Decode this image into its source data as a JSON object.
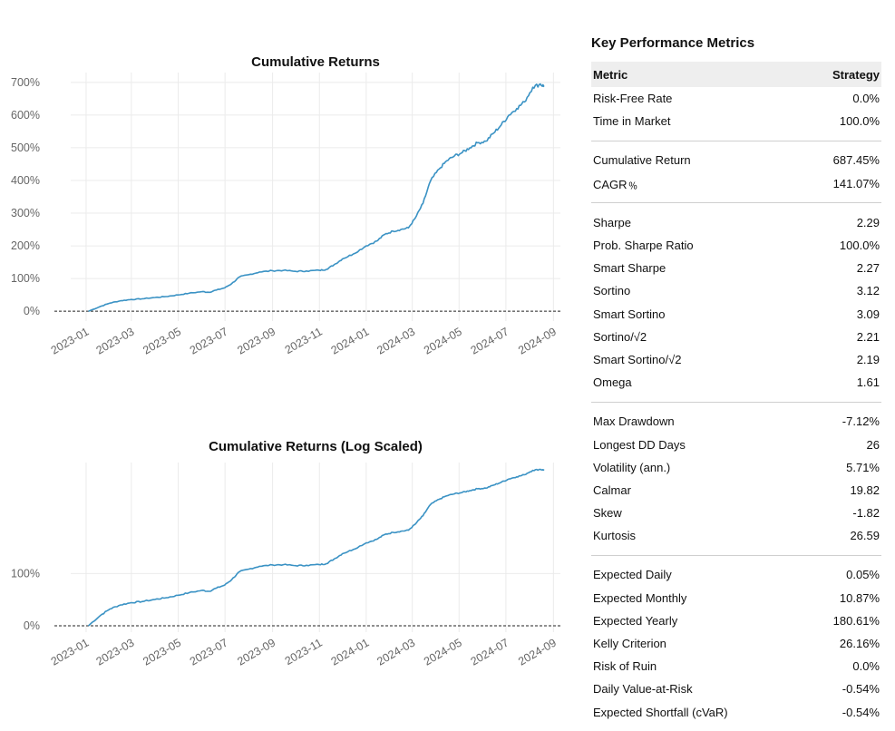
{
  "colors": {
    "series": "#3a92c4",
    "grid": "#ebebeb",
    "zero_line": "#222222",
    "header_bg": "#eeeeee"
  },
  "chart_data": [
    {
      "type": "line",
      "title": "Cumulative Returns",
      "xlabel": "",
      "ylabel": "",
      "y_scale": "linear",
      "ylim": [
        -0.3,
        7.3
      ],
      "y_ticks": [
        0,
        1,
        2,
        3,
        4,
        5,
        6,
        7
      ],
      "y_tick_labels": [
        "0%",
        "100%",
        "200%",
        "300%",
        "400%",
        "500%",
        "600%",
        "700%"
      ],
      "x_ticks": [
        "2023-01",
        "2023-03",
        "2023-05",
        "2023-07",
        "2023-09",
        "2023-11",
        "2024-01",
        "2024-03",
        "2024-05",
        "2024-07",
        "2024-09"
      ],
      "grid": true,
      "series": [
        {
          "x": [
            "2023-01-04",
            "2023-01-20",
            "2023-02-01",
            "2023-02-15",
            "2023-03-01",
            "2023-03-15",
            "2023-04-01",
            "2023-04-15",
            "2023-05-01",
            "2023-05-15",
            "2023-06-01",
            "2023-06-10",
            "2023-06-20",
            "2023-07-01",
            "2023-07-10",
            "2023-07-20",
            "2023-08-01",
            "2023-08-15",
            "2023-09-01",
            "2023-09-15",
            "2023-10-01",
            "2023-10-15",
            "2023-11-01",
            "2023-11-10",
            "2023-11-20",
            "2023-12-01",
            "2023-12-15",
            "2024-01-01",
            "2024-01-15",
            "2024-01-25",
            "2024-02-05",
            "2024-02-15",
            "2024-02-25",
            "2024-03-05",
            "2024-03-15",
            "2024-03-25",
            "2024-04-05",
            "2024-04-15",
            "2024-04-25",
            "2024-05-05",
            "2024-05-15",
            "2024-05-25",
            "2024-06-05",
            "2024-06-15",
            "2024-06-25",
            "2024-07-05",
            "2024-07-15",
            "2024-07-25",
            "2024-08-05",
            "2024-08-15",
            "2024-08-20"
          ],
          "y": [
            0.0,
            0.15,
            0.25,
            0.32,
            0.36,
            0.38,
            0.42,
            0.45,
            0.5,
            0.55,
            0.6,
            0.58,
            0.65,
            0.72,
            0.85,
            1.05,
            1.12,
            1.2,
            1.24,
            1.25,
            1.22,
            1.23,
            1.25,
            1.28,
            1.42,
            1.6,
            1.75,
            2.0,
            2.15,
            2.35,
            2.45,
            2.5,
            2.55,
            2.85,
            3.3,
            4.0,
            4.35,
            4.6,
            4.75,
            4.85,
            5.0,
            5.15,
            5.2,
            5.45,
            5.7,
            6.0,
            6.2,
            6.4,
            6.85,
            6.95,
            6.87
          ]
        }
      ]
    },
    {
      "type": "line",
      "title": "Cumulative Returns (Log Scaled)",
      "xlabel": "",
      "ylabel": "",
      "y_scale": "log1p",
      "y_ticks": [
        0,
        1
      ],
      "y_tick_labels": [
        "0%",
        "100%"
      ],
      "x_ticks": [
        "2023-01",
        "2023-03",
        "2023-05",
        "2023-07",
        "2023-09",
        "2023-11",
        "2024-01",
        "2024-03",
        "2024-05",
        "2024-07",
        "2024-09"
      ],
      "grid": true,
      "series": [
        {
          "x": [
            "2023-01-04",
            "2023-01-20",
            "2023-02-01",
            "2023-02-15",
            "2023-03-01",
            "2023-03-15",
            "2023-04-01",
            "2023-04-15",
            "2023-05-01",
            "2023-05-15",
            "2023-06-01",
            "2023-06-10",
            "2023-06-20",
            "2023-07-01",
            "2023-07-10",
            "2023-07-20",
            "2023-08-01",
            "2023-08-15",
            "2023-09-01",
            "2023-09-15",
            "2023-10-01",
            "2023-10-15",
            "2023-11-01",
            "2023-11-10",
            "2023-11-20",
            "2023-12-01",
            "2023-12-15",
            "2024-01-01",
            "2024-01-15",
            "2024-01-25",
            "2024-02-05",
            "2024-02-15",
            "2024-02-25",
            "2024-03-05",
            "2024-03-15",
            "2024-03-25",
            "2024-04-05",
            "2024-04-15",
            "2024-04-25",
            "2024-05-05",
            "2024-05-15",
            "2024-05-25",
            "2024-06-05",
            "2024-06-15",
            "2024-06-25",
            "2024-07-05",
            "2024-07-15",
            "2024-07-25",
            "2024-08-05",
            "2024-08-15",
            "2024-08-20"
          ],
          "y": [
            0.0,
            0.15,
            0.25,
            0.32,
            0.36,
            0.38,
            0.42,
            0.45,
            0.5,
            0.55,
            0.6,
            0.58,
            0.65,
            0.72,
            0.85,
            1.05,
            1.12,
            1.2,
            1.24,
            1.25,
            1.22,
            1.23,
            1.25,
            1.28,
            1.42,
            1.6,
            1.75,
            2.0,
            2.15,
            2.35,
            2.45,
            2.5,
            2.55,
            2.85,
            3.3,
            4.0,
            4.35,
            4.6,
            4.75,
            4.85,
            5.0,
            5.15,
            5.2,
            5.45,
            5.7,
            6.0,
            6.2,
            6.4,
            6.85,
            6.95,
            6.87
          ]
        }
      ]
    }
  ],
  "metrics": {
    "title": "Key Performance Metrics",
    "header": {
      "metric": "Metric",
      "strategy": "Strategy"
    },
    "groups": [
      [
        [
          "Risk-Free Rate",
          "0.0%"
        ],
        [
          "Time in Market",
          "100.0%"
        ]
      ],
      [
        [
          "Cumulative Return",
          "687.45%"
        ],
        [
          "CAGR﹪",
          "141.07%"
        ]
      ],
      [
        [
          "Sharpe",
          "2.29"
        ],
        [
          "Prob. Sharpe Ratio",
          "100.0%"
        ],
        [
          "Smart Sharpe",
          "2.27"
        ],
        [
          "Sortino",
          "3.12"
        ],
        [
          "Smart Sortino",
          "3.09"
        ],
        [
          "Sortino/√2",
          "2.21"
        ],
        [
          "Smart Sortino/√2",
          "2.19"
        ],
        [
          "Omega",
          "1.61"
        ]
      ],
      [
        [
          "Max Drawdown",
          "-7.12%"
        ],
        [
          "Longest DD Days",
          "26"
        ],
        [
          "Volatility (ann.)",
          "5.71%"
        ],
        [
          "Calmar",
          "19.82"
        ],
        [
          "Skew",
          "-1.82"
        ],
        [
          "Kurtosis",
          "26.59"
        ]
      ],
      [
        [
          "Expected Daily",
          "0.05%"
        ],
        [
          "Expected Monthly",
          "10.87%"
        ],
        [
          "Expected Yearly",
          "180.61%"
        ],
        [
          "Kelly Criterion",
          "26.16%"
        ],
        [
          "Risk of Ruin",
          "0.0%"
        ],
        [
          "Daily Value-at-Risk",
          "-0.54%"
        ],
        [
          "Expected Shortfall (cVaR)",
          "-0.54%"
        ]
      ]
    ]
  }
}
